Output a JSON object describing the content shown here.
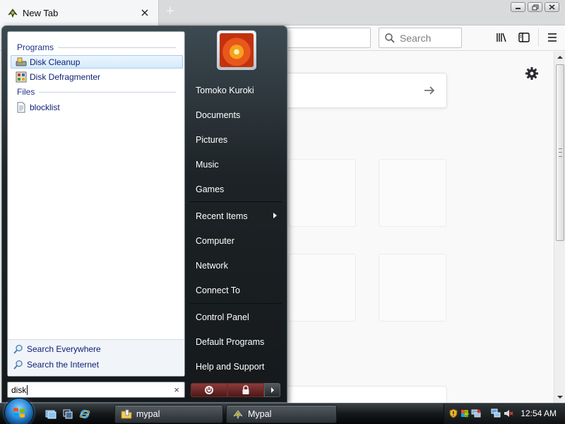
{
  "browser": {
    "tab_title": "New Tab",
    "newtab_symbol": "+",
    "search_placeholder": "Search"
  },
  "start_menu": {
    "groups": {
      "programs": "Programs",
      "files": "Files"
    },
    "results": [
      {
        "label": "Disk Cleanup",
        "icon": "disk-cleanup-icon",
        "selected": true
      },
      {
        "label": "Disk Defragmenter",
        "icon": "disk-defragmenter-icon",
        "selected": false
      },
      {
        "label": "blocklist",
        "icon": "document-icon",
        "selected": false
      }
    ],
    "search_links": {
      "everywhere": "Search Everywhere",
      "internet": "Search the Internet"
    },
    "search_value": "disk",
    "clear_symbol": "×",
    "right_items": {
      "user": "Tomoko Kuroki",
      "documents": "Documents",
      "pictures": "Pictures",
      "music": "Music",
      "games": "Games",
      "recent": "Recent Items",
      "computer": "Computer",
      "network": "Network",
      "connect": "Connect To",
      "control_panel": "Control Panel",
      "default_programs": "Default Programs",
      "help": "Help and Support"
    }
  },
  "taskbar": {
    "tasks": [
      {
        "label": "mypal",
        "icon": "folder-icon"
      },
      {
        "label": "Mypal",
        "icon": "mypal-browser-icon"
      }
    ],
    "clock": "12:54 AM"
  },
  "colors": {
    "start_menu_dark": "#15191b",
    "link_blue": "#0b1e74",
    "power_red": "#8e3a3a"
  }
}
